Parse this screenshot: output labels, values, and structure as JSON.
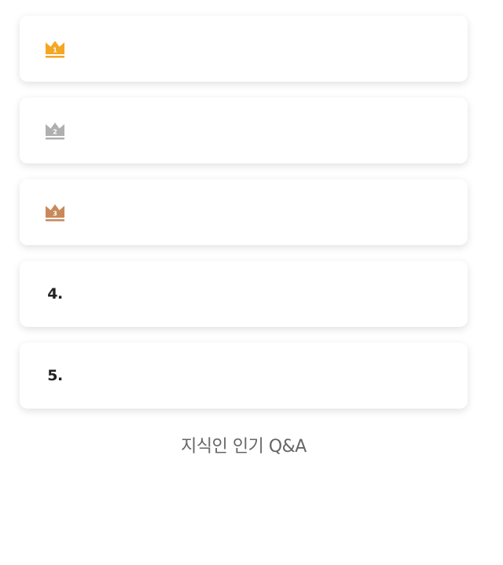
{
  "ranking": {
    "items": [
      {
        "rank": "1",
        "style": "crown",
        "color": "#f5a623"
      },
      {
        "rank": "2",
        "style": "crown",
        "color": "#b0b0b0"
      },
      {
        "rank": "3",
        "style": "crown",
        "color": "#c8895a"
      },
      {
        "rank": "4.",
        "style": "number"
      },
      {
        "rank": "5.",
        "style": "number"
      }
    ]
  },
  "footer": {
    "title": "지식인 인기 Q&A"
  },
  "icons": {
    "crown": "crown-icon"
  }
}
